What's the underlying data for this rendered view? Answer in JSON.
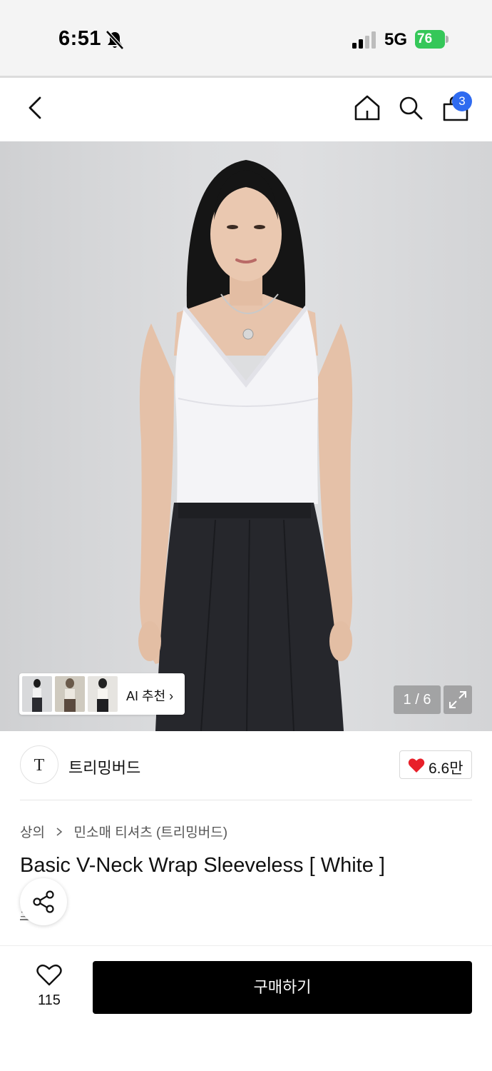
{
  "status_bar": {
    "time": "6:51",
    "network": "5G",
    "battery": "76"
  },
  "nav": {
    "cart_count": "3"
  },
  "gallery": {
    "ai_label": "AI 추천 ›",
    "page_indicator": "1 / 6"
  },
  "brand": {
    "logo_text": "T",
    "name": "트리밍버드",
    "likes": "6.6만"
  },
  "product": {
    "breadcrumb": [
      "상의",
      "민소매 티셔츠 (트리밍버드)"
    ],
    "title": "Basic V-Neck Wrap Sleeveless [ White ]",
    "sub_link": "소개"
  },
  "bottom": {
    "wish_count": "115",
    "buy_label": "구매하기"
  },
  "colors": {
    "accent_blue": "#2f6bf0",
    "heart_red": "#e8202a",
    "buy_button": "#000000"
  }
}
